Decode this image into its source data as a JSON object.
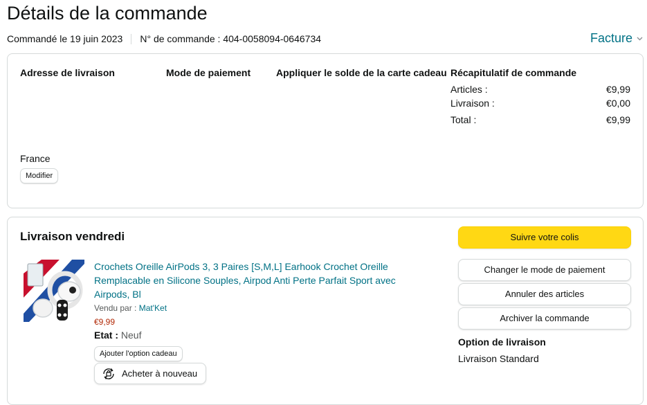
{
  "page": {
    "title": "Détails de la commande",
    "ordered": "Commandé le 19 juin 2023",
    "order_number": "N° de commande : 404-0058094-0646734",
    "invoice_label": "Facture"
  },
  "summary": {
    "shipping_address_heading": "Adresse de livraison",
    "payment_method_heading": "Mode de paiement",
    "gift_card_heading": "Appliquer le solde de la carte cadeau",
    "order_summary_heading": "Récapitulatif de commande",
    "country": "France",
    "modify_button": "Modifier",
    "lines": [
      {
        "label": "Articles :",
        "value": "€9,99"
      },
      {
        "label": "Livraison :",
        "value": "€0,00"
      },
      {
        "label": "Total :",
        "value": "€9,99"
      }
    ]
  },
  "delivery": {
    "heading": "Livraison vendredi",
    "product": {
      "title": "Crochets Oreille AirPods 3, 3 Paires [S,M,L] Earhook Crochet Oreille Remplacable en Silicone Souples, Airpod Anti Perte Parfait Sport avec Airpods, Bl",
      "sold_by_label": "Vendu par :",
      "seller": "Mat'Ket",
      "price": "€9,99",
      "condition_label": "Etat :",
      "condition": "Neuf",
      "gift_button": "Ajouter l'option cadeau",
      "buy_again_button": "Acheter à nouveau"
    },
    "actions": {
      "track": "Suivre votre colis",
      "change_payment": "Changer le mode de paiement",
      "cancel": "Annuler des articles",
      "archive": "Archiver la commande"
    },
    "shipping_option_heading": "Option de livraison",
    "shipping_option": "Livraison Standard"
  },
  "colors": {
    "link": "#007185",
    "primary_button": "#ffd814",
    "price": "#b12704",
    "border": "#d5d9d9"
  }
}
